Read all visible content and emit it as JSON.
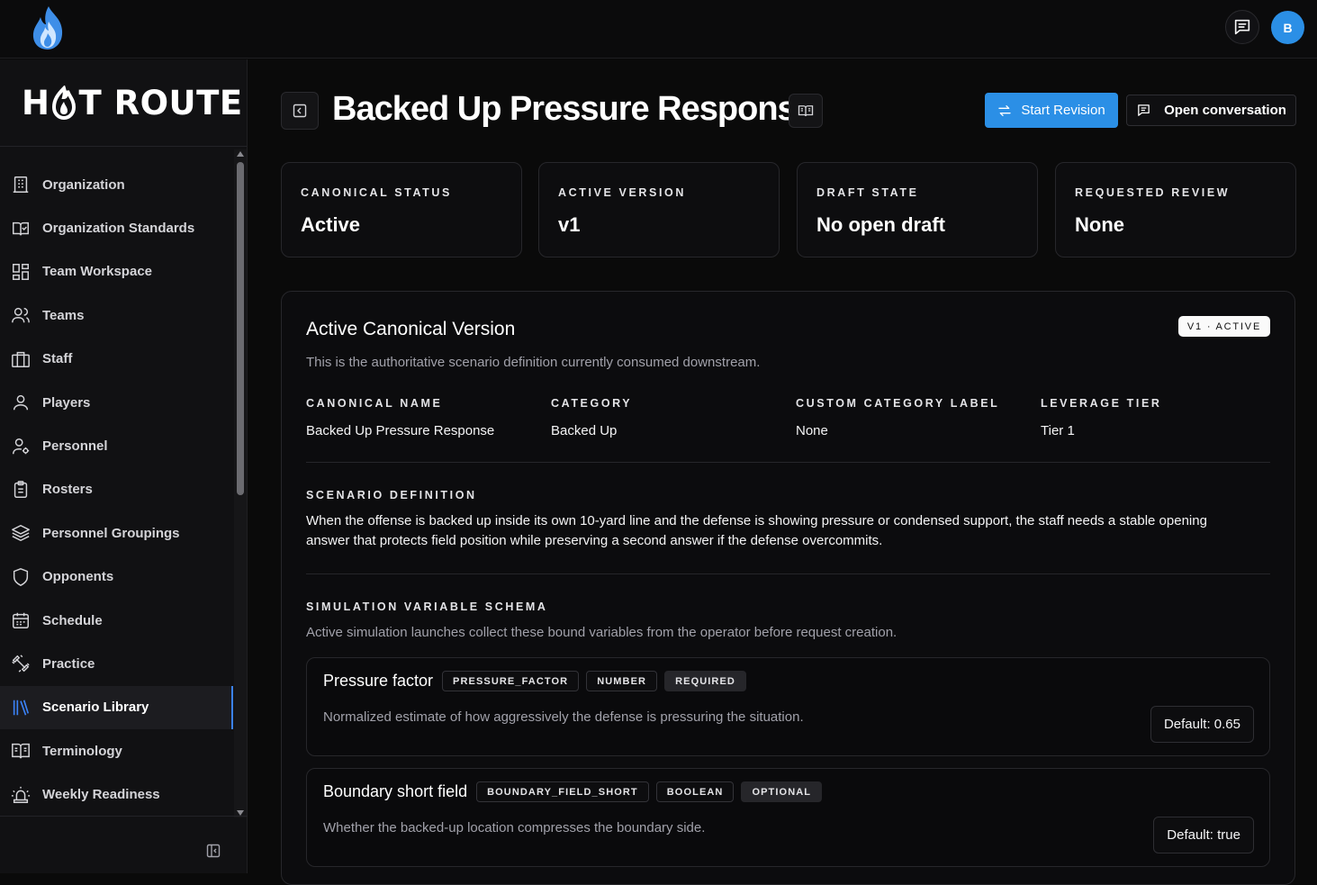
{
  "topbar": {
    "avatar_initial": "B"
  },
  "brand": {
    "prefix": "H",
    "suffix": "T ROUTE"
  },
  "sidebar": {
    "items": [
      {
        "label": "Organization",
        "icon": "building-icon"
      },
      {
        "label": "Organization Standards",
        "icon": "book-check-icon"
      },
      {
        "label": "Team Workspace",
        "icon": "layout-grid-icon"
      },
      {
        "label": "Teams",
        "icon": "users-icon"
      },
      {
        "label": "Staff",
        "icon": "briefcase-icon"
      },
      {
        "label": "Players",
        "icon": "user-icon"
      },
      {
        "label": "Personnel",
        "icon": "user-cog-icon"
      },
      {
        "label": "Rosters",
        "icon": "clipboard-list-icon"
      },
      {
        "label": "Personnel Groupings",
        "icon": "layers-icon"
      },
      {
        "label": "Opponents",
        "icon": "shield-icon"
      },
      {
        "label": "Schedule",
        "icon": "calendar-icon"
      },
      {
        "label": "Practice",
        "icon": "dumbbell-icon"
      },
      {
        "label": "Scenario Library",
        "icon": "library-icon",
        "active": true
      },
      {
        "label": "Terminology",
        "icon": "book-open-text-icon"
      },
      {
        "label": "Weekly Readiness",
        "icon": "siren-icon"
      }
    ]
  },
  "header": {
    "title": "Backed Up Pressure Response",
    "start_revision": "Start Revision",
    "open_conversation": "Open conversation"
  },
  "stats": [
    {
      "label": "CANONICAL STATUS",
      "value": "Active"
    },
    {
      "label": "ACTIVE VERSION",
      "value": "v1"
    },
    {
      "label": "DRAFT STATE",
      "value": "No open draft"
    },
    {
      "label": "REQUESTED REVIEW",
      "value": "None"
    }
  ],
  "panel": {
    "title": "Active Canonical Version",
    "badge": "V1 · ACTIVE",
    "subtitle": "This is the authoritative scenario definition currently consumed downstream.",
    "fields": [
      {
        "label": "CANONICAL NAME",
        "value": "Backed Up Pressure Response"
      },
      {
        "label": "CATEGORY",
        "value": "Backed Up"
      },
      {
        "label": "CUSTOM CATEGORY LABEL",
        "value": "None"
      },
      {
        "label": "LEVERAGE TIER",
        "value": "Tier 1"
      }
    ],
    "definition_label": "SCENARIO DEFINITION",
    "definition_text": "When the offense is backed up inside its own 10-yard line and the defense is showing pressure or condensed support, the staff needs a stable opening answer that protects field position while preserving a second answer if the defense overcommits.",
    "schema_label": "SIMULATION VARIABLE SCHEMA",
    "schema_sub": "Active simulation launches collect these bound variables from the operator before request creation.",
    "variables": [
      {
        "name": "Pressure factor",
        "key": "PRESSURE_FACTOR",
        "type": "NUMBER",
        "req": "REQUIRED",
        "desc": "Normalized estimate of how aggressively the defense is pressuring the situation.",
        "default": "Default: 0.65"
      },
      {
        "name": "Boundary short field",
        "key": "BOUNDARY_FIELD_SHORT",
        "type": "BOOLEAN",
        "req": "OPTIONAL",
        "desc": "Whether the backed-up location compresses the boundary side.",
        "default": "Default: true"
      }
    ]
  },
  "colors": {
    "accent": "#2b8fe6",
    "background": "#0a0a0a",
    "card_border": "#27272b"
  }
}
